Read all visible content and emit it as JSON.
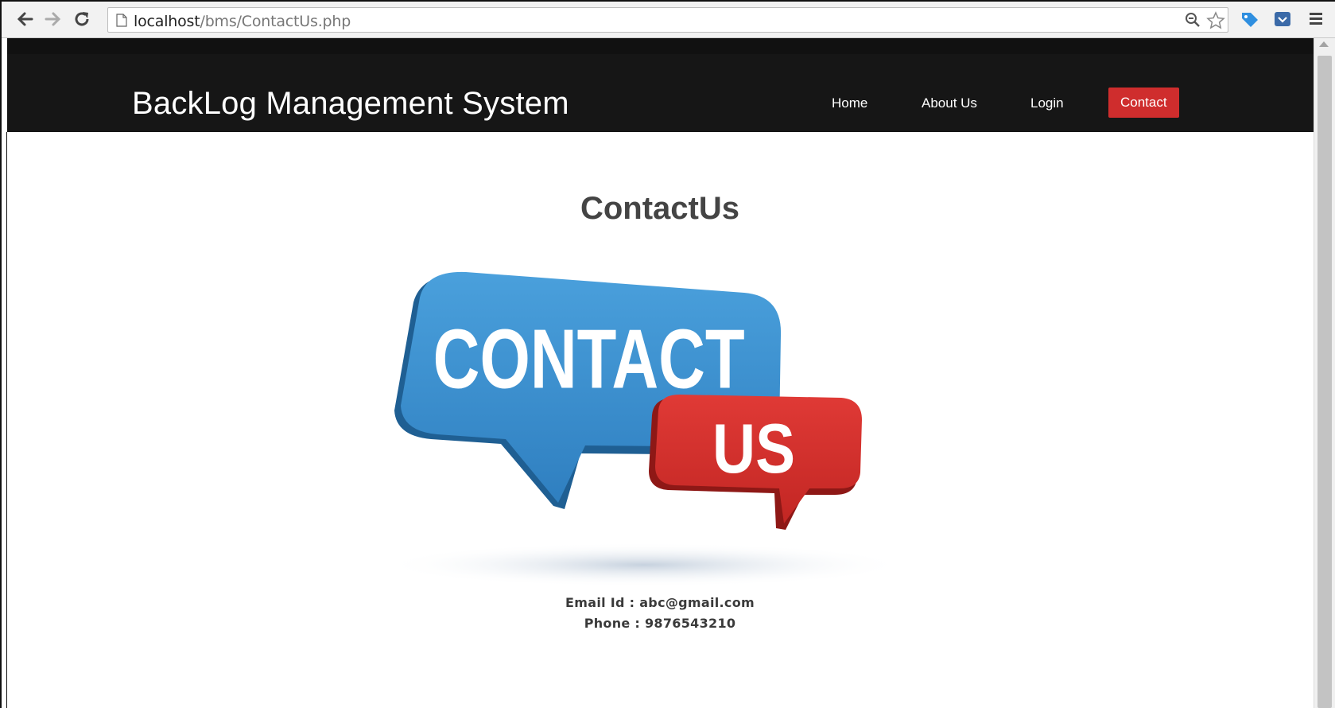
{
  "browser": {
    "url_host": "localhost",
    "url_path": "/bms/ContactUs.php"
  },
  "header": {
    "brand": "BackLog Management System",
    "nav": [
      {
        "label": "Home",
        "active": false
      },
      {
        "label": "About Us",
        "active": false
      },
      {
        "label": "Login",
        "active": false
      },
      {
        "label": "Contact",
        "active": true
      }
    ],
    "accent_color": "#cf2d2d"
  },
  "main": {
    "title": "ContactUs",
    "illustration": {
      "big_bubble_text": "CONTACT",
      "small_bubble_text": "US",
      "big_bubble_color": "#3d8fcf",
      "small_bubble_color": "#d9302e"
    },
    "email_line": "Email Id : abc@gmail.com",
    "phone_line": "Phone : 9876543210"
  },
  "icons": [
    "back-arrow-icon",
    "forward-arrow-icon",
    "reload-icon",
    "page-icon",
    "zoom-icon",
    "star-icon",
    "extension-tag-icon",
    "pocket-icon",
    "menu-icon"
  ]
}
